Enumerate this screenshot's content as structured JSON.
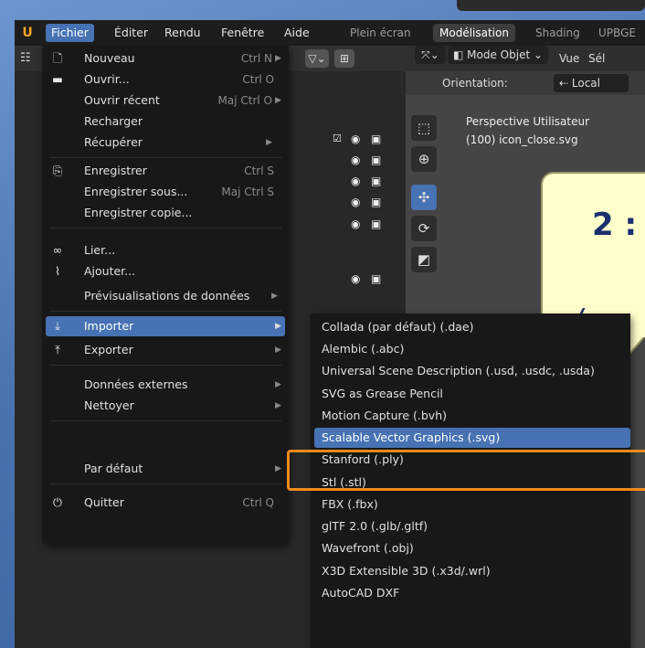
{
  "menubar": {
    "items": [
      "Fichier",
      "Éditer",
      "Rendu",
      "Fenêtre",
      "Aide"
    ],
    "workspace_tabs": [
      "Plein écran",
      "Modélisation",
      "Shading",
      "UPBGE"
    ]
  },
  "viewport": {
    "mode": "Mode Objet",
    "menus": [
      "Vue",
      "Sél"
    ],
    "orientation_label": "Orientation:",
    "orientation_value": "Local",
    "view_name": "Perspective Utilisateur",
    "object_name": "(100) icon_close.svg"
  },
  "file_menu": {
    "items": [
      {
        "icon": "new-file-icon",
        "label": "Nouveau",
        "shortcut": "Ctrl N",
        "submenu": true
      },
      {
        "icon": "folder-icon",
        "label": "Ouvrir...",
        "shortcut": "Ctrl O",
        "submenu": false
      },
      {
        "icon": "",
        "label": "Ouvrir récent",
        "shortcut": "Maj Ctrl O",
        "submenu": true
      },
      {
        "icon": "",
        "label": "Recharger",
        "shortcut": "",
        "submenu": false
      },
      {
        "icon": "",
        "label": "Récupérer",
        "shortcut": "",
        "submenu": true
      },
      {
        "icon": "save-icon",
        "label": "Enregistrer",
        "shortcut": "Ctrl S",
        "submenu": false
      },
      {
        "icon": "",
        "label": "Enregistrer sous...",
        "shortcut": "Maj Ctrl S",
        "submenu": false
      },
      {
        "icon": "",
        "label": "Enregistrer copie...",
        "shortcut": "",
        "submenu": false
      },
      {
        "icon": "link-icon",
        "label": "Lier...",
        "shortcut": "",
        "submenu": false
      },
      {
        "icon": "paperclip-icon",
        "label": "Ajouter...",
        "shortcut": "",
        "submenu": false
      },
      {
        "icon": "",
        "label": "Prévisualisations de données",
        "shortcut": "",
        "submenu": true
      },
      {
        "icon": "import-icon",
        "label": "Importer",
        "shortcut": "",
        "submenu": true,
        "highlighted": true
      },
      {
        "icon": "export-icon",
        "label": "Exporter",
        "shortcut": "",
        "submenu": true
      },
      {
        "icon": "",
        "label": "Données externes",
        "shortcut": "",
        "submenu": true
      },
      {
        "icon": "",
        "label": "Nettoyer",
        "shortcut": "",
        "submenu": true
      },
      {
        "icon": "",
        "label": "Par défaut",
        "shortcut": "",
        "submenu": true
      },
      {
        "icon": "power-icon",
        "label": "Quitter",
        "shortcut": "Ctrl Q",
        "submenu": false
      }
    ]
  },
  "import_submenu": {
    "items": [
      "Collada (par défaut) (.dae)",
      "Alembic (.abc)",
      "Universal Scene Description (.usd, .usdc, .usda)",
      "SVG as Grease Pencil",
      "Motion Capture (.bvh)",
      "Scalable Vector Graphics (.svg)",
      "Stanford (.ply)",
      "Stl (.stl)",
      "FBX (.fbx)",
      "glTF 2.0 (.glb/.gltf)",
      "Wavefront (.obj)",
      "X3D Extensible 3D (.x3d/.wrl)",
      "AutoCAD DXF"
    ],
    "highlighted": "Scalable Vector Graphics (.svg)"
  },
  "callout": {
    "line1": "2 :",
    "line2": "("
  },
  "colors": {
    "accent": "#4772b3",
    "highlight_box": "#f08a1c",
    "callout_bg": "#ffffcc"
  }
}
